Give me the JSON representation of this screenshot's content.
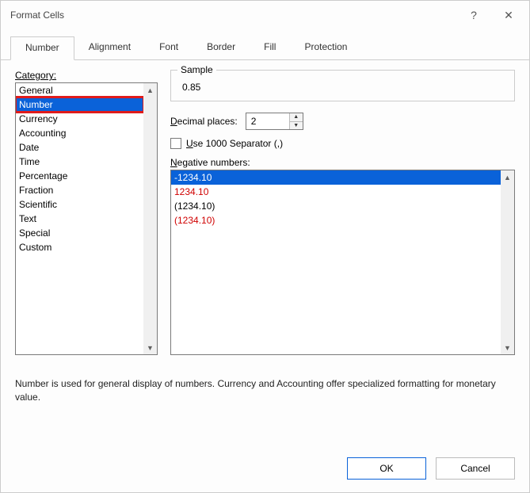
{
  "titlebar": {
    "title": "Format Cells",
    "help_glyph": "?",
    "close_glyph": "✕"
  },
  "tabs": [
    {
      "label": "Number",
      "active": true
    },
    {
      "label": "Alignment",
      "active": false
    },
    {
      "label": "Font",
      "active": false
    },
    {
      "label": "Border",
      "active": false
    },
    {
      "label": "Fill",
      "active": false
    },
    {
      "label": "Protection",
      "active": false
    }
  ],
  "category": {
    "label": "Category:",
    "items": [
      {
        "label": "General"
      },
      {
        "label": "Number",
        "selected": true,
        "highlighted": true
      },
      {
        "label": "Currency"
      },
      {
        "label": "Accounting"
      },
      {
        "label": "Date"
      },
      {
        "label": "Time"
      },
      {
        "label": "Percentage"
      },
      {
        "label": "Fraction"
      },
      {
        "label": "Scientific"
      },
      {
        "label": "Text"
      },
      {
        "label": "Special"
      },
      {
        "label": "Custom"
      }
    ]
  },
  "sample": {
    "group_label": "Sample",
    "value": "0.85"
  },
  "decimal": {
    "label_pre": "D",
    "label_hot": "ecimal places:",
    "value": "2"
  },
  "separator": {
    "label_pre": "U",
    "label_rest": "se 1000 Separator (,)",
    "checked": false
  },
  "negative": {
    "label_pre": "N",
    "label_rest": "egative numbers:",
    "items": [
      {
        "text": "-1234.10",
        "selected": true,
        "color": "default"
      },
      {
        "text": "1234.10",
        "selected": false,
        "color": "red"
      },
      {
        "text": "(1234.10)",
        "selected": false,
        "color": "default"
      },
      {
        "text": "(1234.10)",
        "selected": false,
        "color": "red"
      }
    ]
  },
  "description": "Number is used for general display of numbers.  Currency and Accounting offer specialized formatting for monetary value.",
  "buttons": {
    "ok": "OK",
    "cancel": "Cancel"
  }
}
